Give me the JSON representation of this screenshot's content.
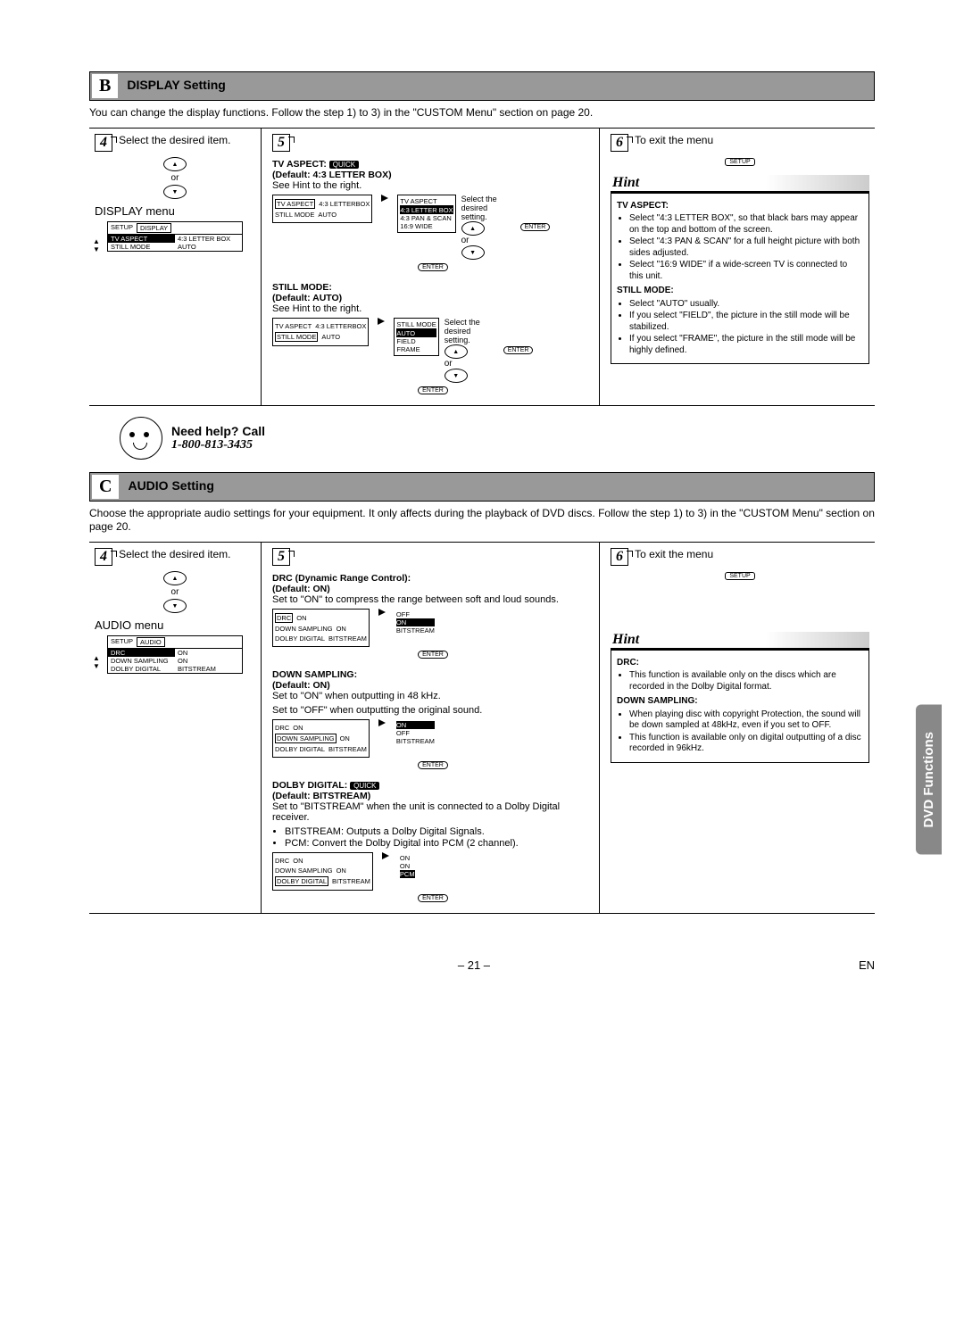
{
  "sections": {
    "b": {
      "letter": "B",
      "title": "DISPLAY Setting",
      "intro": "You can change the display functions. Follow the step 1) to 3) in the \"CUSTOM Menu\" section on page 20."
    },
    "c": {
      "letter": "C",
      "title": "AUDIO Setting",
      "intro": "Choose the appropriate audio settings for your equipment. It only affects during the playback of DVD discs. Follow the step 1) to 3) in the \"CUSTOM Menu\" section on page 20."
    }
  },
  "steps": {
    "n4": "4",
    "n5": "5",
    "n6": "6",
    "t4": "Select the desired item.",
    "t6": "To exit the menu"
  },
  "labels": {
    "or": "or",
    "enter": "ENTER",
    "setup": "SETUP",
    "hint": "Hint",
    "select_setting": "Select the desired setting."
  },
  "display": {
    "menu_title": "DISPLAY menu",
    "menu_tabs": {
      "left": "SETUP",
      "right": "DISPLAY"
    },
    "menu_rows": {
      "r1a": "TV ASPECT",
      "r1b": "4:3 LETTER BOX",
      "r2a": "STILL MODE",
      "r2b": "AUTO"
    },
    "tv_aspect": {
      "head": "TV ASPECT:",
      "quick": "QUICK",
      "default": "(Default: 4:3 LETTER BOX)",
      "hint": "See Hint to the right.",
      "detail_rows": {
        "r1a": "TV ASPECT",
        "r1b": "4:3 LETTERBOX",
        "r2a": "STILL MODE",
        "r2b": "AUTO"
      },
      "options_hl": "TV ASPECT",
      "options": [
        "4:3 LETTER BOX",
        "4:3 PAN & SCAN",
        "16:9 WIDE"
      ]
    },
    "still_mode": {
      "head": "STILL MODE:",
      "default": "(Default: AUTO)",
      "hint": "See Hint to the right.",
      "detail_rows": {
        "r1a": "TV ASPECT",
        "r1b": "4:3 LETTERBOX",
        "r2a": "STILL MODE",
        "r2b": "AUTO"
      },
      "options_hl": "STILL MODE",
      "options": [
        "AUTO",
        "FIELD",
        "FRAME"
      ]
    }
  },
  "audio": {
    "menu_title": "AUDIO menu",
    "menu_tabs": {
      "left": "SETUP",
      "right": "AUDIO"
    },
    "menu_rows": {
      "r1a": "DRC",
      "r1b": "ON",
      "r2a": "DOWN SAMPLING",
      "r2b": "ON",
      "r3a": "DOLBY DIGITAL",
      "r3b": "BITSTREAM"
    },
    "drc": {
      "head": "DRC (Dynamic Range Control):",
      "default": "(Default: ON)",
      "desc": "Set to \"ON\" to compress the range between soft and loud sounds.",
      "rows": {
        "r1a": "DRC",
        "r1b": "ON",
        "r2a": "DOWN SAMPLING",
        "r2b": "ON",
        "r3a": "DOLBY DIGITAL",
        "r3b": "BITSTREAM"
      },
      "opts": [
        "OFF",
        "ON",
        "BITSTREAM"
      ]
    },
    "down": {
      "head": "DOWN SAMPLING:",
      "default": "(Default: ON)",
      "desc1": "Set to \"ON\" when outputting in 48 kHz.",
      "desc2": "Set to \"OFF\" when outputting the original sound.",
      "rows": {
        "r1a": "DRC",
        "r1b": "ON",
        "r2a": "DOWN SAMPLING",
        "r2b": "ON",
        "r3a": "DOLBY DIGITAL",
        "r3b": "BITSTREAM"
      },
      "opts": [
        "ON",
        "OFF",
        "BITSTREAM"
      ]
    },
    "dolby": {
      "head": "DOLBY DIGITAL:",
      "quick": "QUICK",
      "default": "(Default: BITSTREAM)",
      "desc": "Set to \"BITSTREAM\" when the unit is connected to a Dolby Digital receiver.",
      "b1": "BITSTREAM: Outputs a Dolby Digital Signals.",
      "b2": "PCM: Convert the Dolby Digital into PCM (2 channel).",
      "rows": {
        "r1a": "DRC",
        "r1b": "ON",
        "r2a": "DOWN SAMPLING",
        "r2b": "ON",
        "r3a": "DOLBY DIGITAL",
        "r3b": "BITSTREAM"
      },
      "opts": [
        "ON",
        "ON",
        "PCM"
      ]
    }
  },
  "hint_display": {
    "tv_head": "TV ASPECT:",
    "tv1": "Select \"4:3 LETTER BOX\", so that black bars may appear on the top and bottom of the screen.",
    "tv2": "Select \"4:3 PAN & SCAN\" for a full height picture with both sides adjusted.",
    "tv3": "Select \"16:9 WIDE\" if a wide-screen TV is connected to this unit.",
    "st_head": "STILL MODE:",
    "st1": "Select \"AUTO\" usually.",
    "st2": "If you select \"FIELD\", the picture in the still mode will be stabilized.",
    "st3": "If you select \"FRAME\", the picture in the still mode will be highly defined."
  },
  "hint_audio": {
    "drc_head": "DRC:",
    "drc1": "This function is available only on the discs which are recorded in the Dolby Digital format.",
    "ds_head": "DOWN SAMPLING:",
    "ds1": "When playing disc with copyright Protection, the sound will be down sampled at 48kHz, even if you set to OFF.",
    "ds2": "This function is available only on digital outputting of a disc recorded in 96kHz."
  },
  "help": {
    "label": "Need help? Call",
    "phone": "1-800-813-3435"
  },
  "footer": {
    "page": "– 21 –",
    "lang": "EN"
  },
  "sidetab": "DVD Functions"
}
